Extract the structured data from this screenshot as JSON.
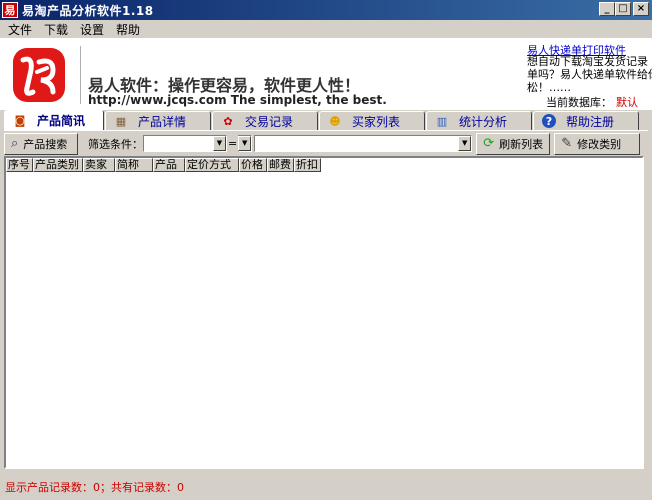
{
  "window": {
    "title": "易淘产品分析软件1.18",
    "icon_letter": "易",
    "buttons": {
      "minimize": "_",
      "maximize": "□",
      "close": "×"
    }
  },
  "menu": [
    "文件",
    "下载",
    "设置",
    "帮助"
  ],
  "banner": {
    "slogan": "易人软件：操作更容易，软件更人性！",
    "website": "http://www.jcqs.com  The simplest, the best.",
    "ad_link": "易人快递单打印软件",
    "ad_lines": [
      "想自动下载淘宝发货记录",
      "单吗？易人快递单软件给你",
      "松！……"
    ],
    "db_label": "当前数据库：",
    "db_value": "默认"
  },
  "tabs": [
    {
      "label": "产品简讯",
      "icon": "product-news-icon",
      "glyph": "◙",
      "color": "#c04000"
    },
    {
      "label": "产品详情",
      "icon": "product-detail-icon",
      "glyph": "▦",
      "color": "#806040"
    },
    {
      "label": "交易记录",
      "icon": "flower-icon",
      "glyph": "✿",
      "color": "#d00000"
    },
    {
      "label": "买家列表",
      "icon": "user-icon",
      "glyph": "☻",
      "color": "#e0a000"
    },
    {
      "label": "统计分析",
      "icon": "bar-chart-icon",
      "glyph": "▥",
      "color": "#3060c0"
    },
    {
      "label": "帮助注册",
      "icon": "help-icon",
      "glyph": "?",
      "color": "#2050c0"
    }
  ],
  "toolbar": {
    "search_label": "产品搜索",
    "filter_label": "筛选条件：",
    "operator": "=",
    "refresh_label": "刷新列表",
    "edit_category_label": "修改类别"
  },
  "grid": {
    "columns": [
      "序号",
      "产品类别",
      "卖家",
      "简称",
      "产品",
      "定价方式",
      "价格",
      "邮费",
      "折扣"
    ]
  },
  "status": "显示产品记录数：0；共有记录数：0"
}
